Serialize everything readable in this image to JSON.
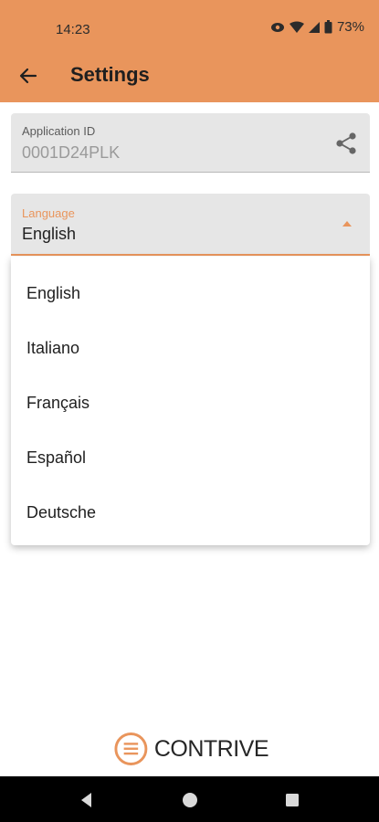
{
  "status_bar": {
    "time": "14:23",
    "battery": "73%",
    "icons": [
      "eye-icon",
      "wifi-icon",
      "signal-icon",
      "battery-icon"
    ]
  },
  "app_bar": {
    "title": "Settings",
    "back_icon": "arrow-left-icon"
  },
  "application_id": {
    "label": "Application ID",
    "value": "0001D24PLK",
    "action_icon": "share-icon"
  },
  "language": {
    "label": "Language",
    "selected": "English",
    "options": [
      "English",
      "Italiano",
      "Français",
      "Español",
      "Deutsche"
    ]
  },
  "footer": {
    "logo_text": "CONTRIVE"
  },
  "nav_bar": {
    "buttons": [
      "back-icon",
      "home-icon",
      "recents-icon"
    ]
  },
  "colors": {
    "accent": "#e9955c",
    "field_bg": "#e6e6e6",
    "nav_bg": "#000000"
  }
}
